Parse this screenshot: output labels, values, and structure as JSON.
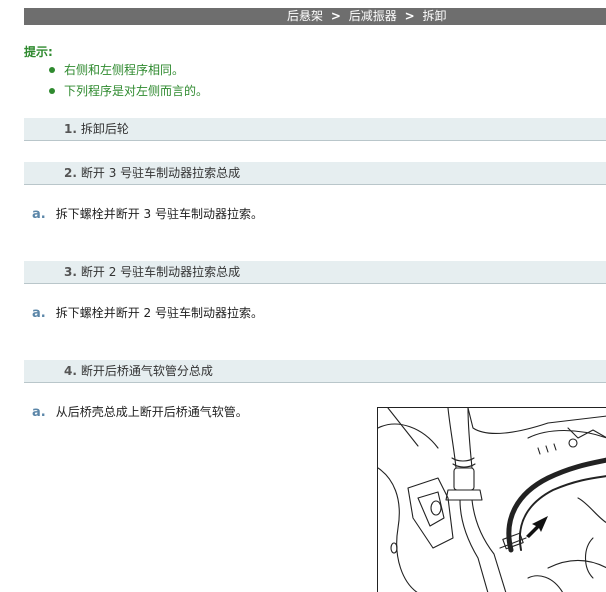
{
  "breadcrumb": {
    "part1": "后悬架",
    "sep": ">",
    "part2": "后减振器",
    "part3": "拆卸"
  },
  "hint": {
    "title": "提示:",
    "items": [
      "右侧和左侧程序相同。",
      "下列程序是对左侧而言的。"
    ]
  },
  "steps": [
    {
      "num": "1.",
      "title": "拆卸后轮"
    },
    {
      "num": "2.",
      "title": "断开 3 号驻车制动器拉索总成",
      "sub": {
        "letter": "a.",
        "text": "拆下螺栓并断开 3 号驻车制动器拉索。"
      }
    },
    {
      "num": "3.",
      "title": "断开 2 号驻车制动器拉索总成",
      "sub": {
        "letter": "a.",
        "text": "拆下螺栓并断开 2 号驻车制动器拉索。"
      }
    },
    {
      "num": "4.",
      "title": "断开后桥通气软管分总成",
      "sub": {
        "letter": "a.",
        "text": "从后桥壳总成上断开后桥通气软管。"
      }
    }
  ],
  "colors": {
    "header_bar": "#6e6e6e",
    "hint_green": "#2f8a2f",
    "step_bg": "#e6eef0",
    "sub_letter": "#5b86a8"
  }
}
